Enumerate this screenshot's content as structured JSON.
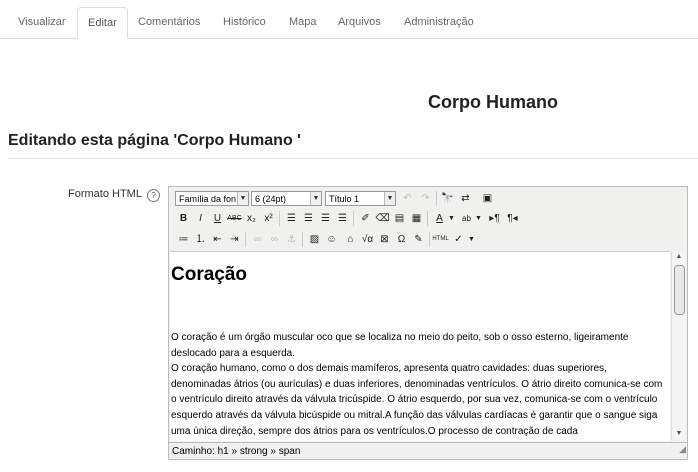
{
  "tabs": [
    "Visualizar",
    "Editar",
    "Comentários",
    "Histórico",
    "Mapa",
    "Arquivos",
    "Administração"
  ],
  "active_tab": "Editar",
  "page_title": "Corpo Humano",
  "section_heading": "Editando esta página 'Corpo Humano '",
  "field_label": "Formato HTML",
  "help_icon": "?",
  "toolbar": {
    "font_family": "Família da fon",
    "font_size": "6 (24pt)",
    "format": "Título 1",
    "bold": "B",
    "italic": "I",
    "underline": "U",
    "strike": "ABC",
    "subscript": "x₂",
    "superscript": "x²",
    "html": "HTML"
  },
  "editor": {
    "heading": "Coração",
    "paragraphs": [
      "O coração é um órgão muscular oco que se localiza no meio do peito, sob o osso esterno, ligeiramente deslocado para a esquerda.",
      "O coração humano, como o dos demais mamíferos, apresenta quatro cavidades: duas superiores, denominadas átrios (ou aurículas) e duas inferiores, denominadas ventrículos. O átrio direito comunica-se com o ventrículo direito através da válvula tricúspide. O átrio esquerdo, por sua vez, comunica-se com o ventrículo esquerdo através da válvula bicúspide ou mitral.A função das válvulas cardíacas é garantir que o sangue siga uma única direção, sempre dos átrios para os ventrículos.O processo de contração de cada"
    ]
  },
  "status_path": "Caminho: h1 » strong » span"
}
